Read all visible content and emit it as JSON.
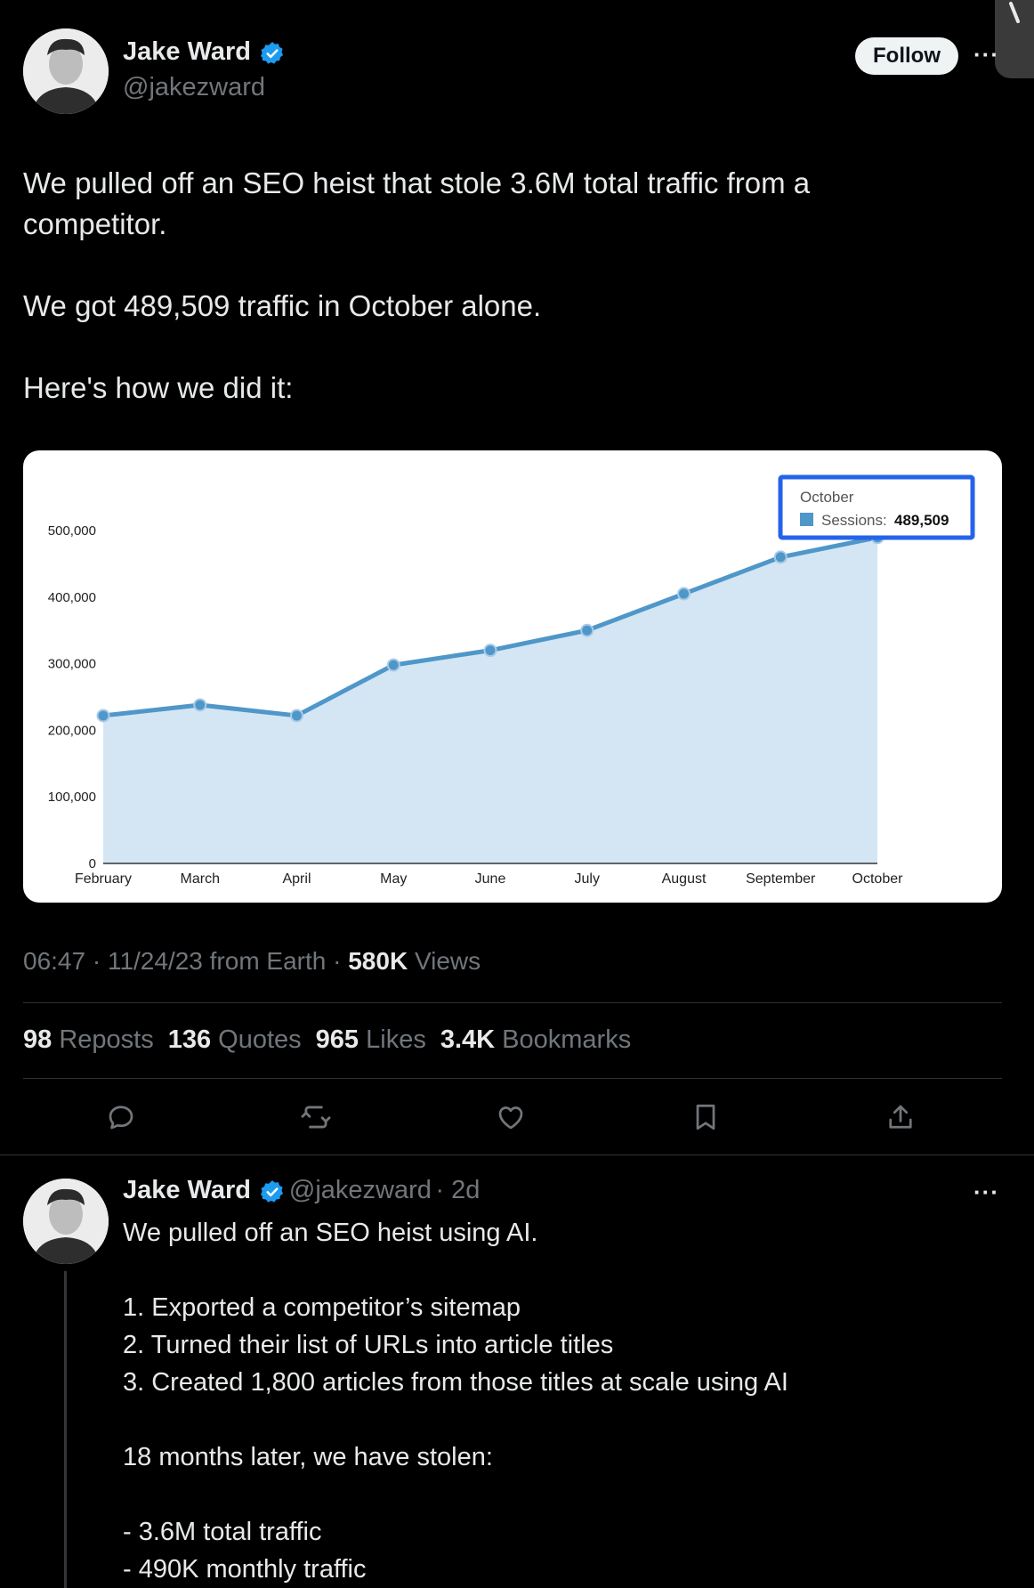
{
  "tweet": {
    "author_name": "Jake Ward",
    "author_handle": "@jakezward",
    "follow_label": "Follow",
    "more_label": "···",
    "text": "We pulled off an SEO heist that stole 3.6M total traffic from a\ncompetitor.\n\nWe got 489,509 traffic in October alone.\n\nHere's how we did it:",
    "meta": {
      "time_date": "06:47 · 11/24/23 from Earth · ",
      "views_count": "580K",
      "views_label": " Views"
    },
    "stats": [
      {
        "count": "98",
        "label": "Reposts"
      },
      {
        "count": "136",
        "label": "Quotes"
      },
      {
        "count": "965",
        "label": "Likes"
      },
      {
        "count": "3.4K",
        "label": "Bookmarks"
      }
    ],
    "actions": [
      "reply-icon",
      "retweet-icon",
      "like-icon",
      "bookmark-icon",
      "share-icon"
    ]
  },
  "chart_data": {
    "type": "area",
    "categories": [
      "February",
      "March",
      "April",
      "May",
      "June",
      "July",
      "August",
      "September",
      "October"
    ],
    "series": [
      {
        "name": "Sessions",
        "values": [
          222000,
          238000,
          222000,
          298000,
          320000,
          350000,
          405000,
          460000,
          489509
        ]
      }
    ],
    "yticks": [
      "500,000",
      "400,000",
      "300,000",
      "200,000",
      "100,000",
      "0"
    ],
    "ylim": [
      0,
      500000
    ],
    "tooltip": {
      "title": "October",
      "series_label": "Sessions:",
      "value": "489,509"
    },
    "colors": {
      "line": "#4f97c9",
      "fill": "#d4e6f4",
      "tooltip_border": "#2563eb"
    },
    "grid": false
  },
  "reply": {
    "author_name": "Jake Ward",
    "author_handle": "@jakezward",
    "age": "· 2d",
    "more_label": "···",
    "text": "We pulled off an SEO heist using AI.\n\n1. Exported a competitor’s sitemap\n2. Turned their list of URLs into article titles\n3. Created 1,800 articles from those titles at scale using AI\n\n18 months later, we have stolen:\n\n- 3.6M total traffic\n- 490K monthly traffic"
  },
  "colors": {
    "verified": "#1d9bf0",
    "background": "#000000",
    "text": "#e7e9ea",
    "muted": "#71767b"
  }
}
